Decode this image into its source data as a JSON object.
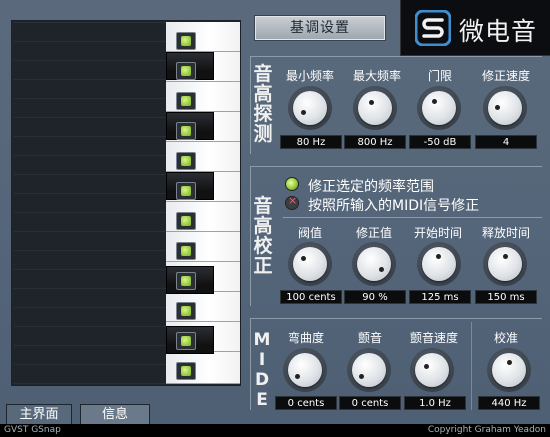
{
  "header": {
    "preset_button": "基调设置",
    "logo_text": "微电音"
  },
  "sections": {
    "detection": {
      "label": "音高探测",
      "knobs": [
        {
          "label": "最小频率",
          "value": "80 Hz"
        },
        {
          "label": "最大频率",
          "value": "800 Hz"
        },
        {
          "label": "门限",
          "value": "-50 dB"
        },
        {
          "label": "修正速度",
          "value": "4"
        }
      ]
    },
    "correction": {
      "label": "音高校正",
      "radios": [
        {
          "label": "修正选定的频率范围",
          "selected": true
        },
        {
          "label": "按照所输入的MIDI信号修正",
          "selected": false
        }
      ],
      "knobs": [
        {
          "label": "阀值",
          "value": "100 cents"
        },
        {
          "label": "修正值",
          "value": "90 %"
        },
        {
          "label": "开始时间",
          "value": "125 ms"
        },
        {
          "label": "释放时间",
          "value": "150 ms"
        }
      ]
    },
    "midi": {
      "label": "MIDE",
      "knobs": [
        {
          "label": "弯曲度",
          "value": "0 cents"
        },
        {
          "label": "颤音",
          "value": "0 cents"
        },
        {
          "label": "颤音速度",
          "value": "1.0 Hz"
        },
        {
          "label": "校准",
          "value": "440 Hz"
        }
      ]
    }
  },
  "tabs": [
    {
      "label": "主界面",
      "active": true
    },
    {
      "label": "信息",
      "active": false
    }
  ],
  "footer": {
    "left": "GVST GSnap",
    "right": "Copyright Graham Yeadon"
  },
  "colors": {
    "background": "#55667a",
    "led_green": "#8fc43a"
  }
}
